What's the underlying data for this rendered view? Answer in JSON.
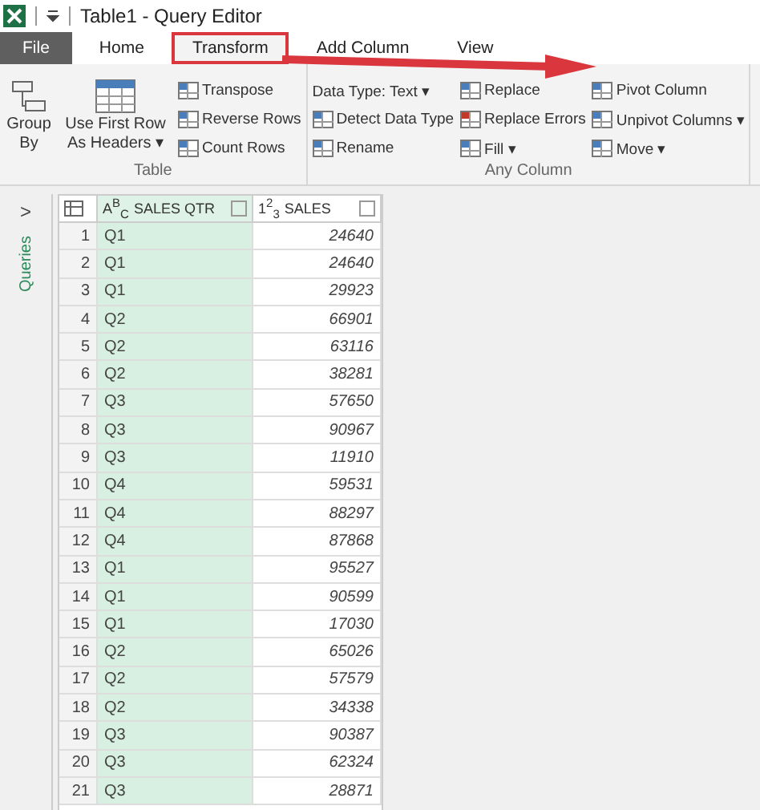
{
  "window": {
    "title": "Table1 - Query Editor"
  },
  "tabs": [
    {
      "label": "File",
      "kind": "file",
      "selected": false,
      "highlighted": false
    },
    {
      "label": "Home",
      "kind": "tab",
      "selected": false,
      "highlighted": false
    },
    {
      "label": "Transform",
      "kind": "tab",
      "selected": true,
      "highlighted": true
    },
    {
      "label": "Add Column",
      "kind": "tab",
      "selected": false,
      "highlighted": false
    },
    {
      "label": "View",
      "kind": "tab",
      "selected": false,
      "highlighted": false
    }
  ],
  "ribbon": {
    "groups": [
      {
        "label": "Table",
        "large": [
          "Group By",
          "Use First Row As Headers ▾"
        ],
        "columns": [
          [
            "Transpose",
            "Reverse Rows",
            "Count Rows"
          ]
        ]
      },
      {
        "label": "Any Column",
        "columns": [
          [
            "Data Type: Text ▾",
            "Detect Data Type",
            "Rename"
          ],
          [
            "Replace",
            "Replace Errors",
            "Fill ▾"
          ],
          [
            "Pivot Column",
            "Unpivot Columns ▾",
            "Move ▾"
          ]
        ]
      }
    ]
  },
  "queries_pane": {
    "label": "Queries",
    "toggle": ">"
  },
  "table": {
    "columns": [
      {
        "kind": "corner",
        "selected": false
      },
      {
        "kind": "text",
        "type_label": "A$^{B}$$_{C}$",
        "name": "SALES QTR",
        "selected": true
      },
      {
        "kind": "number",
        "type_label": "1$^{2}$$_{3}$",
        "name": "SALES",
        "selected": false
      }
    ],
    "rows": [
      [
        "1",
        "Q1",
        "24640"
      ],
      [
        "2",
        "Q1",
        "24640"
      ],
      [
        "3",
        "Q1",
        "29923"
      ],
      [
        "4",
        "Q2",
        "66901"
      ],
      [
        "5",
        "Q2",
        "63116"
      ],
      [
        "6",
        "Q2",
        "38281"
      ],
      [
        "7",
        "Q3",
        "57650"
      ],
      [
        "8",
        "Q3",
        "90967"
      ],
      [
        "9",
        "Q3",
        "11910"
      ],
      [
        "10",
        "Q4",
        "59531"
      ],
      [
        "11",
        "Q4",
        "88297"
      ],
      [
        "12",
        "Q4",
        "87868"
      ],
      [
        "13",
        "Q1",
        "95527"
      ],
      [
        "14",
        "Q1",
        "90599"
      ],
      [
        "15",
        "Q1",
        "17030"
      ],
      [
        "16",
        "Q2",
        "65026"
      ],
      [
        "17",
        "Q2",
        "57579"
      ],
      [
        "18",
        "Q2",
        "34338"
      ],
      [
        "19",
        "Q3",
        "90387"
      ],
      [
        "20",
        "Q3",
        "62324"
      ],
      [
        "21",
        "Q3",
        "28871"
      ]
    ]
  }
}
